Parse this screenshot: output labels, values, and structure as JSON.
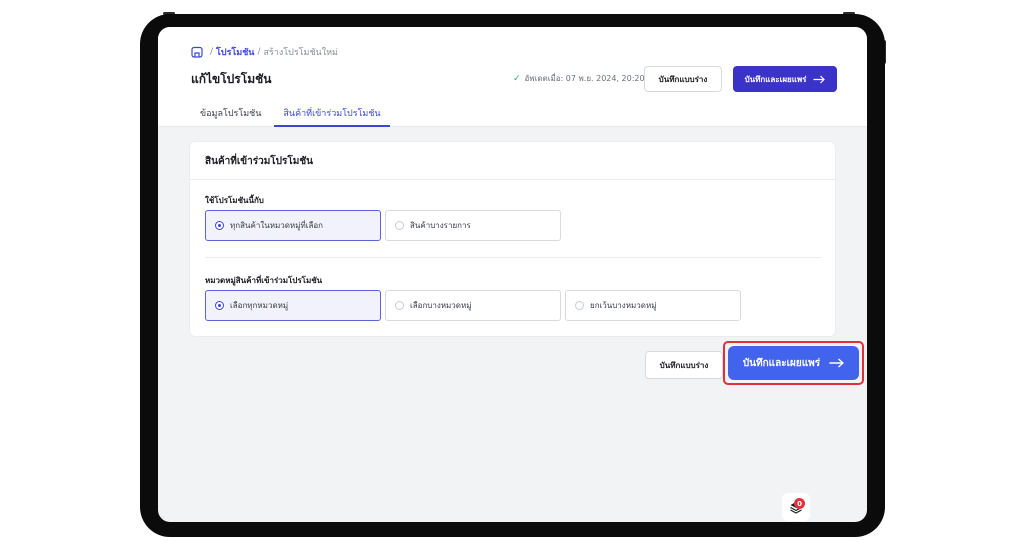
{
  "breadcrumb": {
    "home_icon": "store-icon",
    "link": "โปรโมชัน",
    "current": "สร้างโปรโมชันใหม่"
  },
  "page_title": "แก้ไขโปรโมชัน",
  "saved_status": "อัพเดตเมื่อ: 07 พ.ย. 2024, 20:20",
  "buttons": {
    "save_draft": "บันทึกแบบร่าง",
    "save_publish": "บันทึกและเผยแพร่",
    "arrow_icon": "arrow-right-icon"
  },
  "tabs": [
    {
      "label": "ข้อมูลโปรโมชัน",
      "active": false
    },
    {
      "label": "สินค้าที่เข้าร่วมโปรโมชัน",
      "active": true
    }
  ],
  "card": {
    "title": "สินค้าที่เข้าร่วมโปรโมชัน",
    "apply_section": {
      "label": "ใช้โปรโมชันนี้กับ",
      "options": [
        {
          "label": "ทุกสินค้าในหมวดหมู่ที่เลือก",
          "selected": true
        },
        {
          "label": "สินค้าบางรายการ",
          "selected": false
        }
      ]
    },
    "category_section": {
      "label": "หมวดหมู่สินค้าที่เข้าร่วมโปรโมชัน",
      "options": [
        {
          "label": "เลือกทุกหมวดหมู่",
          "selected": true
        },
        {
          "label": "เลือกบางหมวดหมู่",
          "selected": false
        },
        {
          "label": "ยกเว้นบางหมวดหมู่",
          "selected": false
        }
      ]
    }
  },
  "floating": {
    "icon": "layers-icon",
    "badge_count": "0"
  },
  "colors": {
    "primary": "#3b32c7",
    "accent": "#4263eb",
    "highlight": "#e0303a"
  }
}
